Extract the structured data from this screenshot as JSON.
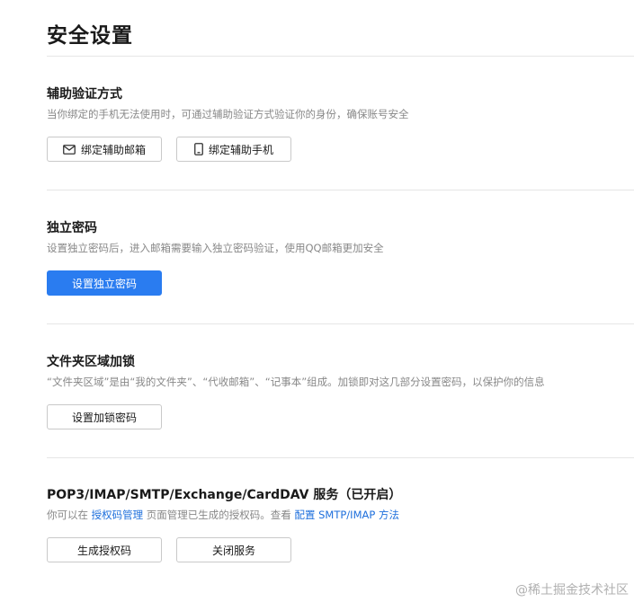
{
  "page": {
    "title": "安全设置"
  },
  "sections": {
    "backup_verify": {
      "title": "辅助验证方式",
      "description": "当你绑定的手机无法使用时，可通过辅助验证方式验证你的身份，确保账号安全",
      "bind_email_label": "绑定辅助邮箱",
      "bind_phone_label": "绑定辅助手机"
    },
    "independent_password": {
      "title": "独立密码",
      "description": "设置独立密码后，进入邮箱需要输入独立密码验证，使用QQ邮箱更加安全",
      "set_password_label": "设置独立密码"
    },
    "folder_lock": {
      "title": "文件夹区域加锁",
      "description": "“文件夹区域”是由“我的文件夹”、“代收邮箱”、“记事本”组成。加锁即对这几部分设置密码，以保护你的信息",
      "set_lock_password_label": "设置加锁密码"
    },
    "protocol_service": {
      "title": "POP3/IMAP/SMTP/Exchange/CardDAV 服务（已开启）",
      "desc_part1": "你可以在 ",
      "auth_code_manage_link": "授权码管理",
      "desc_part2": " 页面管理已生成的授权码。查看 ",
      "config_link": "配置 SMTP/IMAP 方法",
      "generate_code_label": "生成授权码",
      "close_service_label": "关闭服务"
    }
  },
  "watermark": "@稀土掘金技术社区",
  "icons": {
    "email": "envelope-icon",
    "phone": "mobile-phone-icon"
  },
  "colors": {
    "primary": "#2a7cf0",
    "link": "#1e6fdc",
    "muted_text": "#888888",
    "divider": "#e6e6e6"
  }
}
